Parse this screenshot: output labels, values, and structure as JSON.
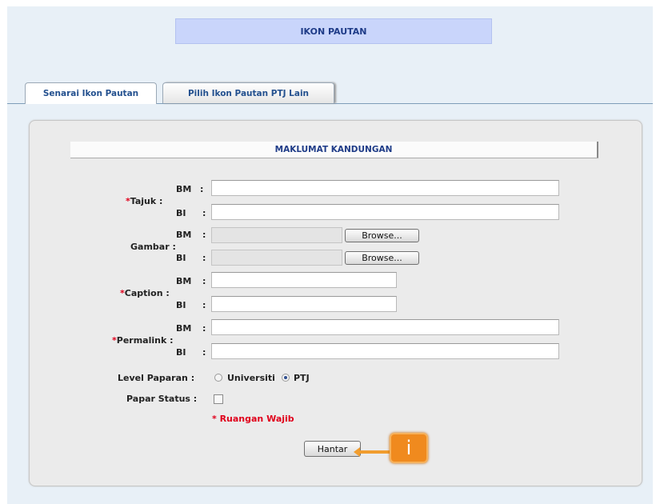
{
  "page": {
    "title": "IKON PAUTAN"
  },
  "tabs": [
    {
      "label": "Senarai Ikon Pautan",
      "active": true
    },
    {
      "label": "Pilih Ikon Pautan PTJ Lain",
      "active": false
    }
  ],
  "section": {
    "title": "MAKLUMAT KANDUNGAN"
  },
  "form": {
    "required_marker": "*",
    "colon": ":",
    "sub_bm": "BM",
    "sub_bi": "BI",
    "tajuk": {
      "label": "Tajuk :",
      "bm_value": "",
      "bi_value": ""
    },
    "gambar": {
      "label": "Gambar :",
      "browse_label": "Browse..."
    },
    "caption": {
      "label": "Caption :",
      "bm_value": "",
      "bi_value": ""
    },
    "permalink": {
      "label": "Permalink :",
      "bm_value": "",
      "bi_value": ""
    },
    "level_paparan": {
      "label": "Level Paparan :",
      "options": [
        "Universiti",
        "PTJ"
      ],
      "selected": "PTJ"
    },
    "papar_status": {
      "label": "Papar Status :",
      "checked": false
    },
    "required_note": "* Ruangan Wajib",
    "submit_label": "Hantar"
  },
  "callout": {
    "icon": "info-icon",
    "text": "i"
  },
  "colors": {
    "title_bar_bg": "#c9d5fb",
    "required": "#e0001b",
    "callout": "#f08a1e",
    "tab_text": "#24518f"
  }
}
